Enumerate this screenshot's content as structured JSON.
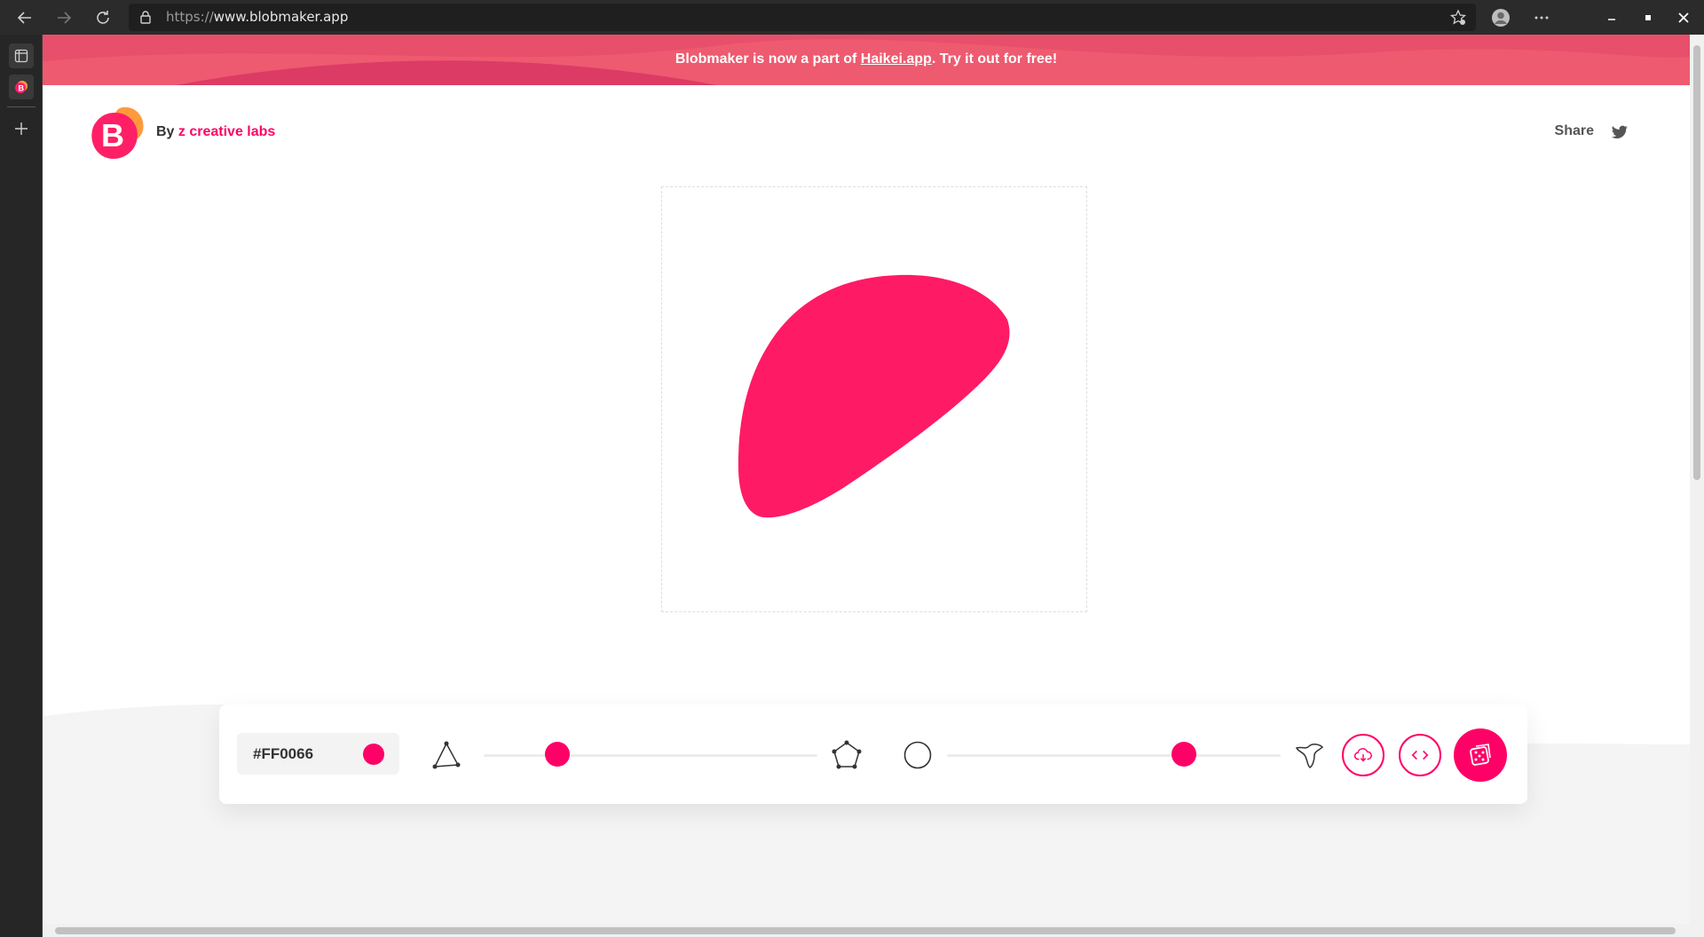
{
  "browser": {
    "url_scheme": "https://",
    "url_host": "www.blobmaker.app"
  },
  "banner": {
    "text_before": "Blobmaker is now a part of ",
    "link_text": "Haikei.app",
    "text_after": ". Try it out for free!"
  },
  "header": {
    "by_label": "By ",
    "brand": "z creative labs",
    "share_label": "Share"
  },
  "controls": {
    "color_hex": "#FF0066",
    "accent_color": "#ff0066",
    "complexity_value": 0.22,
    "contrast_value": 0.71
  },
  "icons": [
    "back-arrow-icon",
    "forward-arrow-icon",
    "reload-icon",
    "lock-icon",
    "favorites-icon",
    "profile-icon",
    "more-icon",
    "minimize-icon",
    "maximize-icon",
    "close-icon",
    "tab-panel-icon",
    "new-tab-icon",
    "twitter-icon",
    "triangle-icon",
    "pentagon-icon",
    "circle-icon",
    "star-blob-icon",
    "download-icon",
    "code-icon",
    "dice-icon"
  ]
}
